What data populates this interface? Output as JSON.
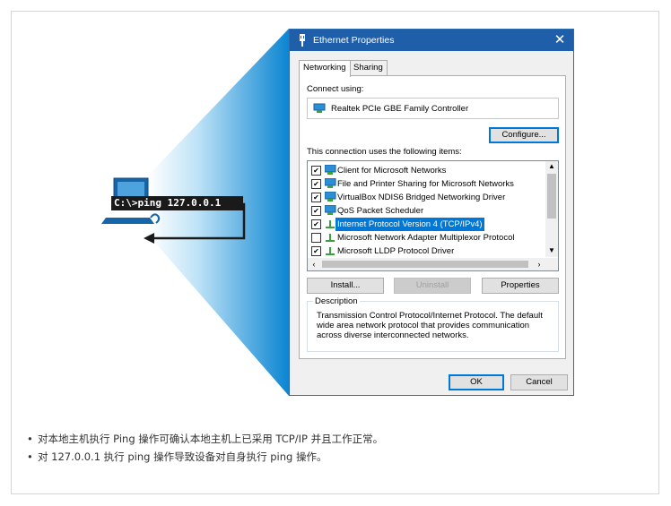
{
  "dialog": {
    "title": "Ethernet Properties",
    "close_glyph": "✕",
    "tabs": [
      {
        "label": "Networking",
        "active": true
      },
      {
        "label": "Sharing",
        "active": false
      }
    ],
    "connect_using_label": "Connect using:",
    "adapter_name": "Realtek PCIe GBE Family Controller",
    "configure_label": "Configure...",
    "items_label": "This connection uses the following items:",
    "items": [
      {
        "checked": true,
        "icon": "network-client-icon",
        "label": "Client for Microsoft Networks",
        "selected": false
      },
      {
        "checked": true,
        "icon": "network-client-icon",
        "label": "File and Printer Sharing for Microsoft Networks",
        "selected": false
      },
      {
        "checked": true,
        "icon": "network-client-icon",
        "label": "VirtualBox NDIS6 Bridged Networking Driver",
        "selected": false
      },
      {
        "checked": true,
        "icon": "qos-icon",
        "label": "QoS Packet Scheduler",
        "selected": false
      },
      {
        "checked": true,
        "icon": "protocol-icon",
        "label": "Internet Protocol Version 4 (TCP/IPv4)",
        "selected": true
      },
      {
        "checked": false,
        "icon": "protocol-icon",
        "label": "Microsoft Network Adapter Multiplexor Protocol",
        "selected": false
      },
      {
        "checked": true,
        "icon": "protocol-icon",
        "label": "Microsoft LLDP Protocol Driver",
        "selected": false
      }
    ],
    "install_label": "Install...",
    "uninstall_label": "Uninstall",
    "properties_label": "Properties",
    "description_legend": "Description",
    "description_text": "Transmission Control Protocol/Internet Protocol. The default wide area network protocol that provides communication across diverse interconnected networks.",
    "ok_label": "OK",
    "cancel_label": "Cancel"
  },
  "command": {
    "text": "C:\\>ping 127.0.0.1"
  },
  "notes": [
    {
      "bullet": "•",
      "text": "对本地主机执行 Ping 操作可确认本地主机上已采用 TCP/IP 并且工作正常。"
    },
    {
      "bullet": "•",
      "text": "对 127.0.0.1 执行 ping 操作导致设备对自身执行 ping 操作。"
    }
  ],
  "colors": {
    "titlebar": "#1f5faa",
    "selection": "#0078d7",
    "beam": "#1e8fd6",
    "computer": "#1565a8"
  }
}
